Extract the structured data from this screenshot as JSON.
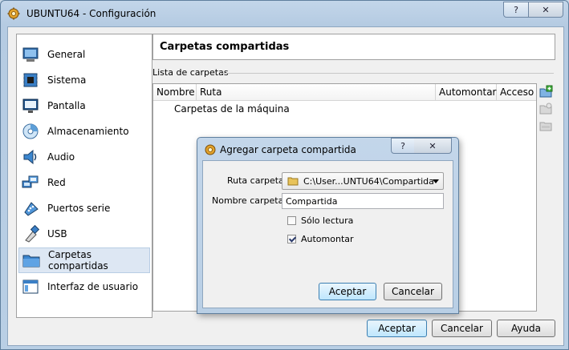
{
  "window": {
    "title": "UBUNTU64 - Configuración",
    "help_label": "?",
    "close_label": "✕"
  },
  "sidebar": {
    "items": [
      {
        "label": "General",
        "icon": "general-icon"
      },
      {
        "label": "Sistema",
        "icon": "chip-icon"
      },
      {
        "label": "Pantalla",
        "icon": "monitor-icon"
      },
      {
        "label": "Almacenamiento",
        "icon": "disk-icon"
      },
      {
        "label": "Audio",
        "icon": "speaker-icon"
      },
      {
        "label": "Red",
        "icon": "network-icon"
      },
      {
        "label": "Puertos serie",
        "icon": "serial-port-icon"
      },
      {
        "label": "USB",
        "icon": "usb-icon"
      },
      {
        "label": "Carpetas compartidas",
        "icon": "folder-icon",
        "selected": true
      },
      {
        "label": "Interfaz de usuario",
        "icon": "ui-window-icon"
      }
    ]
  },
  "main": {
    "title": "Carpetas compartidas",
    "group_label": "Lista de carpetas",
    "columns": [
      "Nombre",
      "Ruta",
      "Automontar",
      "Acceso"
    ],
    "rows": [
      {
        "label": "Carpetas de la máquina"
      }
    ]
  },
  "buttons": {
    "ok": "Aceptar",
    "cancel": "Cancelar",
    "help": "Ayuda"
  },
  "dialog": {
    "title": "Agregar carpeta compartida",
    "help_label": "?",
    "close_label": "✕",
    "path_label": "Ruta carpeta:",
    "path_value": "C:\\User...UNTU64\\Compartida",
    "name_label": "Nombre carpeta:",
    "name_value": "Compartida",
    "readonly_label": "Sólo lectura",
    "readonly_checked": false,
    "automount_label": "Automontar",
    "automount_checked": true,
    "ok": "Aceptar",
    "cancel": "Cancelar"
  },
  "colors": {
    "accent": "#3c7fb1",
    "selected_bg": "#dde7f3",
    "title_bar": "#c3d6ea"
  }
}
